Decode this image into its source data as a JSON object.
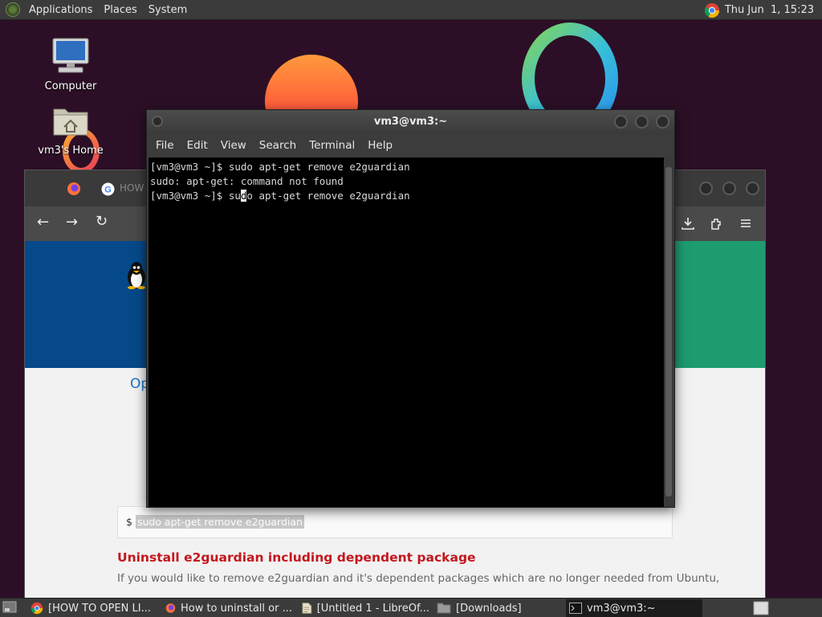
{
  "top_panel": {
    "menus": [
      "Applications",
      "Places",
      "System"
    ],
    "clock": "Thu Jun  1, 15:23"
  },
  "desktop": {
    "icons": [
      {
        "label": "Computer",
        "icon": "computer-icon"
      },
      {
        "label": "vm3's Home",
        "icon": "home-folder-icon"
      }
    ]
  },
  "browser": {
    "tab_fragment": "HOW",
    "page_link_fragment": "Op",
    "command_box": {
      "prompt": "$",
      "command": "sudo apt-get remove e2guardian"
    },
    "section_heading": "Uninstall e2guardian including dependent package",
    "section_text": "If you would like to remove e2guardian and it's dependent packages which are no longer needed from Ubuntu,"
  },
  "terminal": {
    "title": "vm3@vm3:~",
    "menus": [
      "File",
      "Edit",
      "View",
      "Search",
      "Terminal",
      "Help"
    ],
    "lines": [
      "[vm3@vm3 ~]$ sudo apt-get remove e2guardian",
      "sudo: apt-get: command not found"
    ],
    "current_line": {
      "before": "[vm3@vm3 ~]$ su",
      "cursor_char": "d",
      "after": "o apt-get remove e2guardian"
    }
  },
  "taskbar": {
    "tasks": [
      {
        "label": "[HOW TO OPEN LI...",
        "icon": "chrome-icon"
      },
      {
        "label": "How to uninstall or ...",
        "icon": "firefox-icon"
      },
      {
        "label": "[Untitled 1 - LibreOf...",
        "icon": "libreoffice-icon"
      },
      {
        "label": "[Downloads]",
        "icon": "folder-icon"
      },
      {
        "label": "vm3@vm3:~",
        "icon": "terminal-icon"
      }
    ]
  },
  "colors": {
    "desktop_bg": "#2c0f26",
    "heading_red": "#c4161c",
    "link_blue": "#1a73c8"
  }
}
